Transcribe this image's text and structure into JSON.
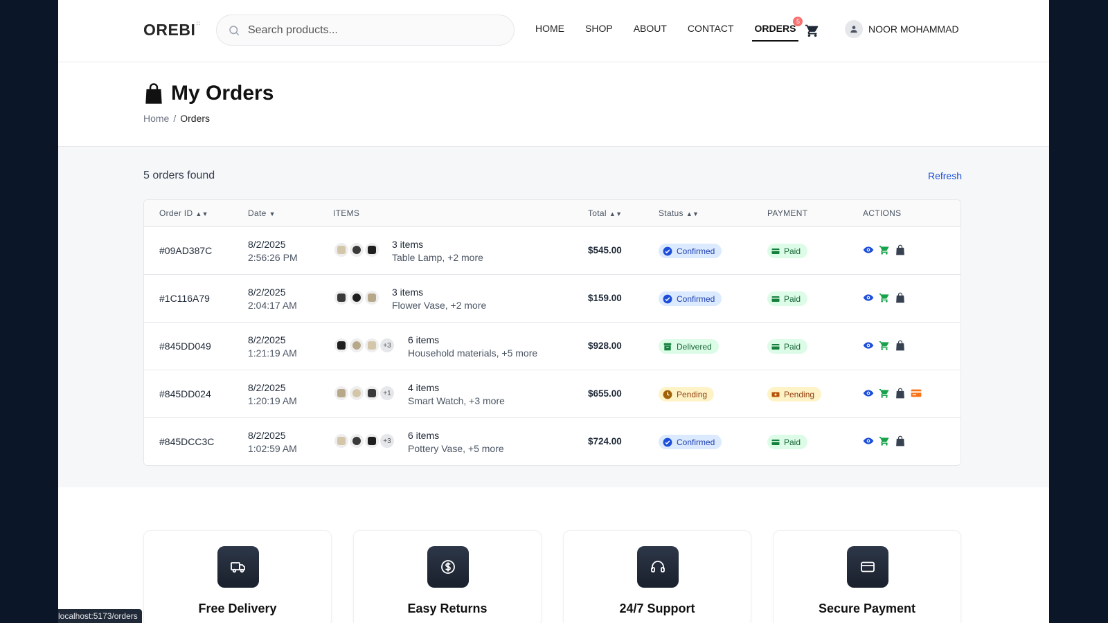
{
  "header": {
    "logo": "OREBI",
    "logo_mark": "::",
    "search_placeholder": "Search products...",
    "nav": [
      {
        "label": "HOME"
      },
      {
        "label": "SHOP"
      },
      {
        "label": "ABOUT"
      },
      {
        "label": "CONTACT"
      },
      {
        "label": "ORDERS",
        "badge": "5"
      }
    ],
    "user_name": "NOOR MOHAMMAD"
  },
  "page": {
    "title": "My Orders",
    "breadcrumb": {
      "home": "Home",
      "sep": "/",
      "current": "Orders"
    }
  },
  "orders": {
    "count_text": "5 orders found",
    "refresh_label": "Refresh",
    "columns": {
      "order_id": "Order ID",
      "date": "Date",
      "items": "ITEMS",
      "total": "Total",
      "status": "Status",
      "payment": "PAYMENT",
      "actions": "ACTIONS"
    },
    "rows": [
      {
        "id": "#09AD387C",
        "date": "8/2/2025",
        "time": "2:56:26 PM",
        "extra": "",
        "items_count": "3 items",
        "items_desc": "Table Lamp, +2 more",
        "total": "$545.00",
        "status": "Confirmed",
        "payment": "Paid"
      },
      {
        "id": "#1C116A79",
        "date": "8/2/2025",
        "time": "2:04:17 AM",
        "extra": "",
        "items_count": "3 items",
        "items_desc": "Flower Vase, +2 more",
        "total": "$159.00",
        "status": "Confirmed",
        "payment": "Paid"
      },
      {
        "id": "#845DD049",
        "date": "8/2/2025",
        "time": "1:21:19 AM",
        "extra": "+3",
        "items_count": "6 items",
        "items_desc": "Household materials, +5 more",
        "total": "$928.00",
        "status": "Delivered",
        "payment": "Paid"
      },
      {
        "id": "#845DD024",
        "date": "8/2/2025",
        "time": "1:20:19 AM",
        "extra": "+1",
        "items_count": "4 items",
        "items_desc": "Smart Watch, +3 more",
        "total": "$655.00",
        "status": "Pending",
        "payment": "Pending"
      },
      {
        "id": "#845DCC3C",
        "date": "8/2/2025",
        "time": "1:02:59 AM",
        "extra": "+3",
        "items_count": "6 items",
        "items_desc": "Pottery Vase, +5 more",
        "total": "$724.00",
        "status": "Confirmed",
        "payment": "Paid"
      }
    ]
  },
  "features": [
    {
      "title": "Free Delivery",
      "icon": "truck-icon"
    },
    {
      "title": "Easy Returns",
      "icon": "dollar-circle-icon"
    },
    {
      "title": "24/7 Support",
      "icon": "headset-icon"
    },
    {
      "title": "Secure Payment",
      "icon": "credit-card-icon"
    }
  ],
  "statusbar": {
    "url": "localhost:5173/orders"
  },
  "colors": {
    "accent_blue": "#1d4ed8",
    "confirmed_bg": "#dbeafe",
    "paid_bg": "#dcfce7",
    "pending_bg": "#fef3c7",
    "cart_green": "#16a34a",
    "card_orange": "#f97316",
    "page_bg": "#0b1628"
  }
}
